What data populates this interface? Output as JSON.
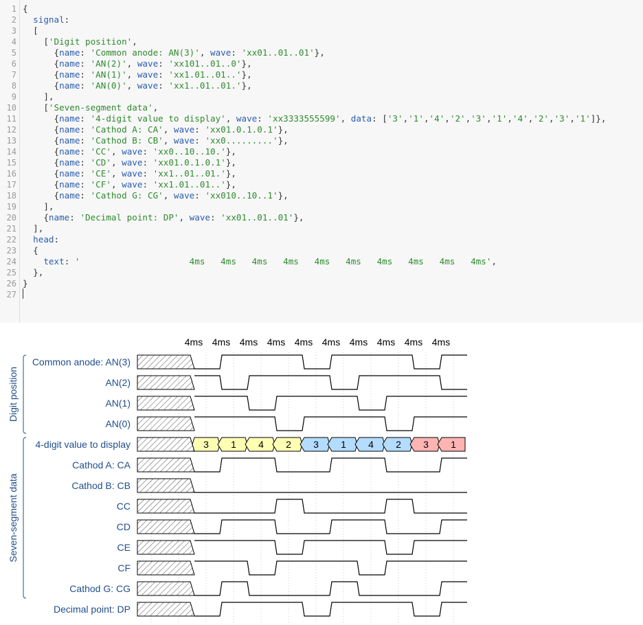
{
  "editor": {
    "lines": [
      [
        [
          "{",
          "pun"
        ]
      ],
      [
        [
          "  ",
          "pun"
        ],
        [
          "signal",
          "key"
        ],
        [
          ":",
          "pun"
        ]
      ],
      [
        [
          "  [",
          "pun"
        ]
      ],
      [
        [
          "    [",
          "pun"
        ],
        [
          "'Digit position'",
          "str"
        ],
        [
          ",",
          "pun"
        ]
      ],
      [
        [
          "      {",
          "pun"
        ],
        [
          "name",
          "key"
        ],
        [
          ": ",
          "pun"
        ],
        [
          "'Common anode: AN(3)'",
          "str"
        ],
        [
          ", ",
          "pun"
        ],
        [
          "wave",
          "key"
        ],
        [
          ": ",
          "pun"
        ],
        [
          "'xx01..01..01'",
          "str"
        ],
        [
          "},",
          "pun"
        ]
      ],
      [
        [
          "      {",
          "pun"
        ],
        [
          "name",
          "key"
        ],
        [
          ": ",
          "pun"
        ],
        [
          "'AN(2)'",
          "str"
        ],
        [
          ", ",
          "pun"
        ],
        [
          "wave",
          "key"
        ],
        [
          ": ",
          "pun"
        ],
        [
          "'xx101..01..0'",
          "str"
        ],
        [
          "},",
          "pun"
        ]
      ],
      [
        [
          "      {",
          "pun"
        ],
        [
          "name",
          "key"
        ],
        [
          ": ",
          "pun"
        ],
        [
          "'AN(1)'",
          "str"
        ],
        [
          ", ",
          "pun"
        ],
        [
          "wave",
          "key"
        ],
        [
          ": ",
          "pun"
        ],
        [
          "'xx1.01..01..'",
          "str"
        ],
        [
          "},",
          "pun"
        ]
      ],
      [
        [
          "      {",
          "pun"
        ],
        [
          "name",
          "key"
        ],
        [
          ": ",
          "pun"
        ],
        [
          "'AN(0)'",
          "str"
        ],
        [
          ", ",
          "pun"
        ],
        [
          "wave",
          "key"
        ],
        [
          ": ",
          "pun"
        ],
        [
          "'xx1..01..01.'",
          "str"
        ],
        [
          "},",
          "pun"
        ]
      ],
      [
        [
          "    ],",
          "pun"
        ]
      ],
      [
        [
          "    [",
          "pun"
        ],
        [
          "'Seven-segment data'",
          "str"
        ],
        [
          ",",
          "pun"
        ]
      ],
      [
        [
          "      {",
          "pun"
        ],
        [
          "name",
          "key"
        ],
        [
          ": ",
          "pun"
        ],
        [
          "'4-digit value to display'",
          "str"
        ],
        [
          ", ",
          "pun"
        ],
        [
          "wave",
          "key"
        ],
        [
          ": ",
          "pun"
        ],
        [
          "'xx3333555599'",
          "str"
        ],
        [
          ", ",
          "pun"
        ],
        [
          "data",
          "key"
        ],
        [
          ": [",
          "pun"
        ],
        [
          "'3'",
          "str"
        ],
        [
          ",",
          "pun"
        ],
        [
          "'1'",
          "str"
        ],
        [
          ",",
          "pun"
        ],
        [
          "'4'",
          "str"
        ],
        [
          ",",
          "pun"
        ],
        [
          "'2'",
          "str"
        ],
        [
          ",",
          "pun"
        ],
        [
          "'3'",
          "str"
        ],
        [
          ",",
          "pun"
        ],
        [
          "'1'",
          "str"
        ],
        [
          ",",
          "pun"
        ],
        [
          "'4'",
          "str"
        ],
        [
          ",",
          "pun"
        ],
        [
          "'2'",
          "str"
        ],
        [
          ",",
          "pun"
        ],
        [
          "'3'",
          "str"
        ],
        [
          ",",
          "pun"
        ],
        [
          "'1'",
          "str"
        ],
        [
          "]},",
          "pun"
        ]
      ],
      [
        [
          "      {",
          "pun"
        ],
        [
          "name",
          "key"
        ],
        [
          ": ",
          "pun"
        ],
        [
          "'Cathod A: CA'",
          "str"
        ],
        [
          ", ",
          "pun"
        ],
        [
          "wave",
          "key"
        ],
        [
          ": ",
          "pun"
        ],
        [
          "'xx01.0.1.0.1'",
          "str"
        ],
        [
          "},",
          "pun"
        ]
      ],
      [
        [
          "      {",
          "pun"
        ],
        [
          "name",
          "key"
        ],
        [
          ": ",
          "pun"
        ],
        [
          "'Cathod B: CB'",
          "str"
        ],
        [
          ", ",
          "pun"
        ],
        [
          "wave",
          "key"
        ],
        [
          ": ",
          "pun"
        ],
        [
          "'xx0.........'",
          "str"
        ],
        [
          "},",
          "pun"
        ]
      ],
      [
        [
          "      {",
          "pun"
        ],
        [
          "name",
          "key"
        ],
        [
          ": ",
          "pun"
        ],
        [
          "'CC'",
          "str"
        ],
        [
          ", ",
          "pun"
        ],
        [
          "wave",
          "key"
        ],
        [
          ": ",
          "pun"
        ],
        [
          "'xx0..10..10.'",
          "str"
        ],
        [
          "},",
          "pun"
        ]
      ],
      [
        [
          "      {",
          "pun"
        ],
        [
          "name",
          "key"
        ],
        [
          ": ",
          "pun"
        ],
        [
          "'CD'",
          "str"
        ],
        [
          ", ",
          "pun"
        ],
        [
          "wave",
          "key"
        ],
        [
          ": ",
          "pun"
        ],
        [
          "'xx01.0.1.0.1'",
          "str"
        ],
        [
          "},",
          "pun"
        ]
      ],
      [
        [
          "      {",
          "pun"
        ],
        [
          "name",
          "key"
        ],
        [
          ": ",
          "pun"
        ],
        [
          "'CE'",
          "str"
        ],
        [
          ", ",
          "pun"
        ],
        [
          "wave",
          "key"
        ],
        [
          ": ",
          "pun"
        ],
        [
          "'xx1..01..01.'",
          "str"
        ],
        [
          "},",
          "pun"
        ]
      ],
      [
        [
          "      {",
          "pun"
        ],
        [
          "name",
          "key"
        ],
        [
          ": ",
          "pun"
        ],
        [
          "'CF'",
          "str"
        ],
        [
          ", ",
          "pun"
        ],
        [
          "wave",
          "key"
        ],
        [
          ": ",
          "pun"
        ],
        [
          "'xx1.01..01..'",
          "str"
        ],
        [
          "},",
          "pun"
        ]
      ],
      [
        [
          "      {",
          "pun"
        ],
        [
          "name",
          "key"
        ],
        [
          ": ",
          "pun"
        ],
        [
          "'Cathod G: CG'",
          "str"
        ],
        [
          ", ",
          "pun"
        ],
        [
          "wave",
          "key"
        ],
        [
          ": ",
          "pun"
        ],
        [
          "'xx010..10..1'",
          "str"
        ],
        [
          "},",
          "pun"
        ]
      ],
      [
        [
          "    ],",
          "pun"
        ]
      ],
      [
        [
          "    {",
          "pun"
        ],
        [
          "name",
          "key"
        ],
        [
          ": ",
          "pun"
        ],
        [
          "'Decimal point: DP'",
          "str"
        ],
        [
          ", ",
          "pun"
        ],
        [
          "wave",
          "key"
        ],
        [
          ": ",
          "pun"
        ],
        [
          "'xx01..01..01'",
          "str"
        ],
        [
          "},",
          "pun"
        ]
      ],
      [
        [
          "  ],",
          "pun"
        ]
      ],
      [
        [
          "  ",
          "pun"
        ],
        [
          "head",
          "key"
        ],
        [
          ":",
          "pun"
        ]
      ],
      [
        [
          "  {",
          "pun"
        ],
        [
          "",
          "pun"
        ]
      ],
      [
        [
          "    ",
          "pun"
        ],
        [
          "text",
          "key"
        ],
        [
          ": ",
          "pun"
        ],
        [
          "'                     4ms   4ms   4ms   4ms   4ms   4ms   4ms   4ms   4ms   4ms'",
          "str"
        ],
        [
          ",",
          "pun"
        ]
      ],
      [
        [
          "  },",
          "pun"
        ]
      ],
      [
        [
          "}",
          "pun"
        ]
      ],
      [
        [
          "",
          "pun"
        ]
      ]
    ]
  },
  "diagram": {
    "head": [
      "4ms",
      "4ms",
      "4ms",
      "4ms",
      "4ms",
      "4ms",
      "4ms",
      "4ms",
      "4ms",
      "4ms"
    ],
    "groups": [
      {
        "name": "Digit position",
        "first": 0,
        "last": 3
      },
      {
        "name": "Seven-segment data",
        "first": 4,
        "last": 11
      }
    ],
    "signals": [
      {
        "name": "Common anode: AN(3)",
        "wave": "xx01..01..01"
      },
      {
        "name": "AN(2)",
        "wave": "xx101..01..0"
      },
      {
        "name": "AN(1)",
        "wave": "xx1.01..01.."
      },
      {
        "name": "AN(0)",
        "wave": "xx1..01..01."
      },
      {
        "name": "4-digit value to display",
        "wave": "xx3333555599",
        "data": [
          "3",
          "1",
          "4",
          "2",
          "3",
          "1",
          "4",
          "2",
          "3",
          "1"
        ]
      },
      {
        "name": "Cathod A: CA",
        "wave": "xx01.0.1.0.1"
      },
      {
        "name": "Cathod B: CB",
        "wave": "xx0........."
      },
      {
        "name": "CC",
        "wave": "xx0..10..10."
      },
      {
        "name": "CD",
        "wave": "xx01.0.1.0.1"
      },
      {
        "name": "CE",
        "wave": "xx1..01..01."
      },
      {
        "name": "CF",
        "wave": "xx1.01..01.."
      },
      {
        "name": "Cathod G: CG",
        "wave": "xx010..10..1"
      },
      {
        "name": "Decimal point: DP",
        "wave": "xx01..01..01"
      }
    ],
    "colors": {
      "text": "#1f4e8c",
      "line": "#000000",
      "grid": "#c8c8c8",
      "hatch": "#666666",
      "bus3": "#ffffb4",
      "bus5": "#b4dcff",
      "bus9": "#ffb4b4"
    }
  }
}
